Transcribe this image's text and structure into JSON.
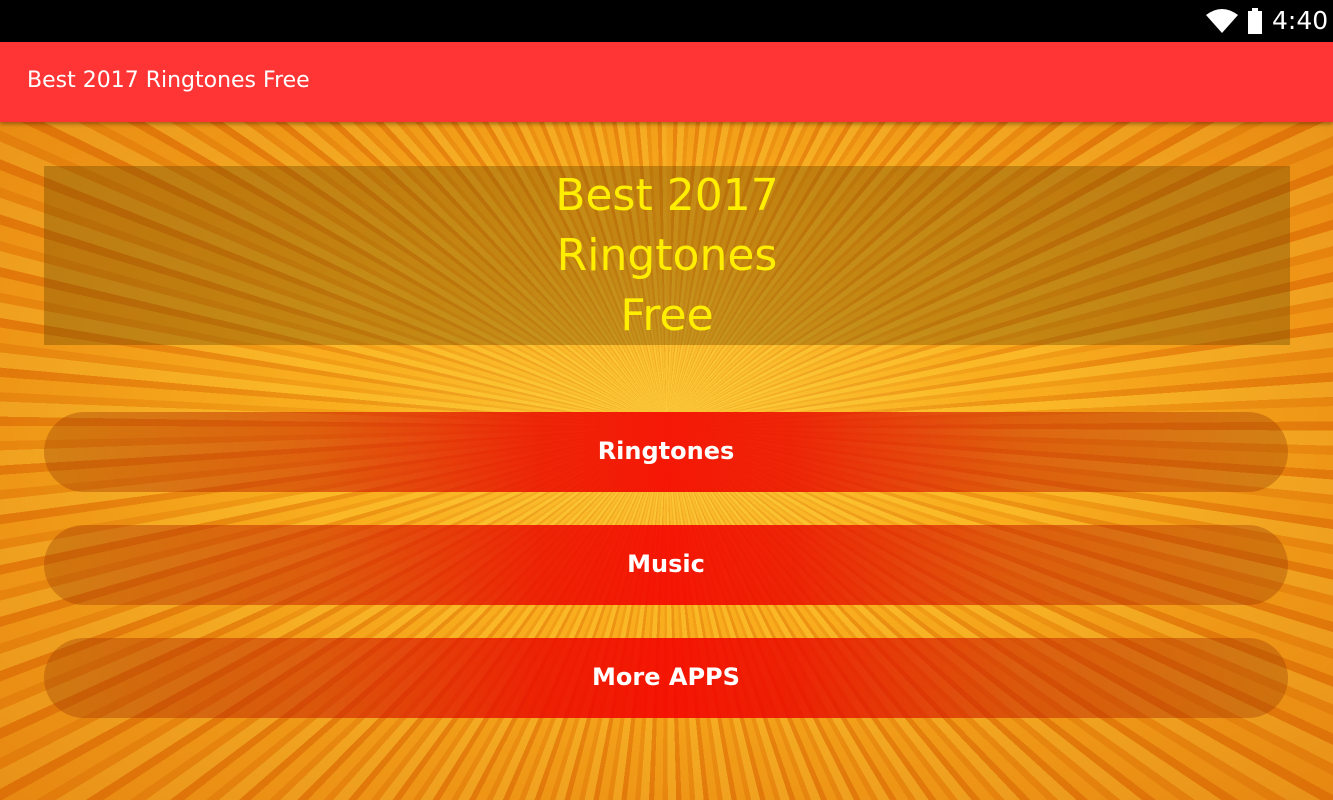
{
  "status_bar": {
    "time": "4:40",
    "icons": [
      "wifi-icon",
      "battery-icon"
    ]
  },
  "app_bar": {
    "title": "Best 2017 Ringtones Free"
  },
  "heading": {
    "lines": [
      "Best 2017",
      "Ringtones",
      "Free"
    ]
  },
  "buttons": {
    "ringtones": "Ringtones",
    "music": "Music",
    "more_apps": "More APPS"
  },
  "colors": {
    "status_bar": "#000000",
    "app_bar": "#ff3535",
    "heading_text": "#ffee00",
    "button_center": "#f50500",
    "button_text": "#ffffff",
    "background": "#f29a10"
  }
}
